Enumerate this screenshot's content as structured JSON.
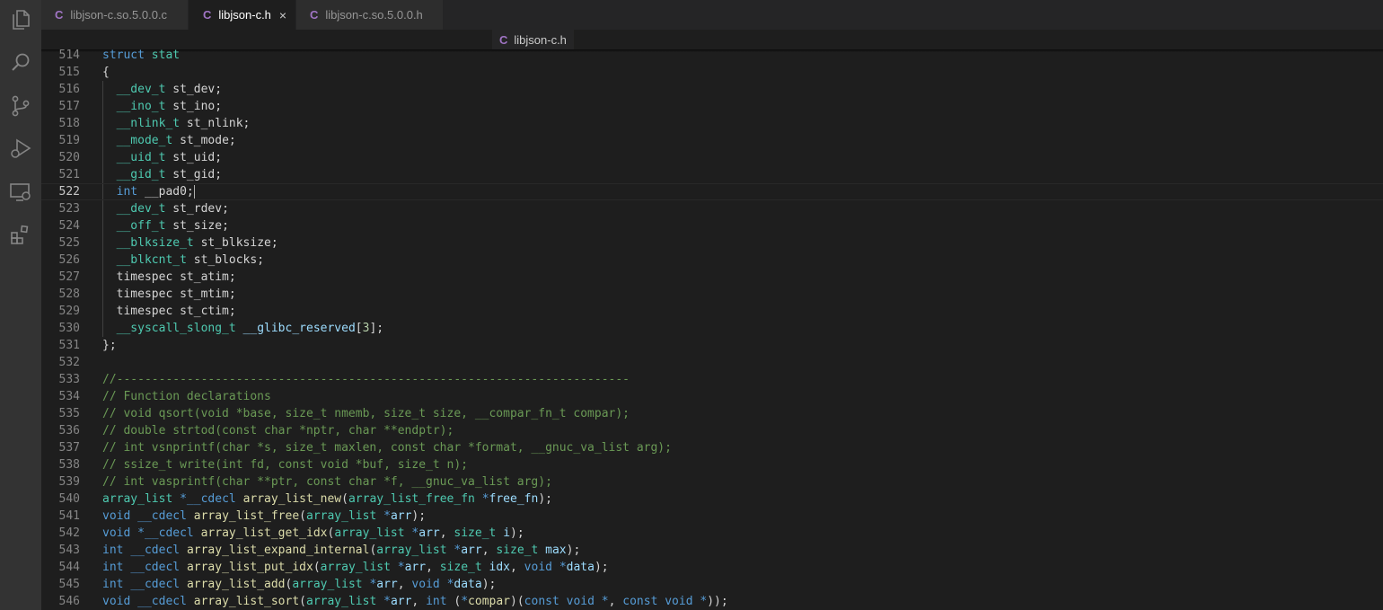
{
  "tabs": [
    {
      "label": "libjson-c.so.5.0.0.c",
      "active": false
    },
    {
      "label": "libjson-c.h",
      "active": true,
      "close": "×"
    },
    {
      "label": "libjson-c.so.5.0.0.h",
      "active": false
    }
  ],
  "file_icon": "C",
  "breadcrumb": {
    "label": "libjson-c.h"
  },
  "activity_icons": [
    "explorer-icon",
    "search-icon",
    "source-control-icon",
    "run-debug-icon",
    "remote-explorer-icon",
    "extensions-icon"
  ],
  "colors": {
    "keyword": "#569cd6",
    "type": "#4ec9b0",
    "function": "#dcdcaa",
    "variable": "#9cdcfe",
    "comment": "#6a9955",
    "number": "#b5cea8",
    "text": "#d4d4d4"
  },
  "editor": {
    "current_line": 522,
    "lines": [
      {
        "n": "514",
        "t": [
          [
            "kw",
            "struct"
          ],
          [
            "",
            " "
          ],
          [
            "ty",
            "stat"
          ]
        ]
      },
      {
        "n": "515",
        "t": [
          [
            "",
            "{"
          ]
        ]
      },
      {
        "n": "516",
        "t": [
          [
            "",
            "  "
          ],
          [
            "ty",
            "__dev_t"
          ],
          [
            "",
            " st_dev;"
          ]
        ]
      },
      {
        "n": "517",
        "t": [
          [
            "",
            "  "
          ],
          [
            "ty",
            "__ino_t"
          ],
          [
            "",
            " st_ino;"
          ]
        ]
      },
      {
        "n": "518",
        "t": [
          [
            "",
            "  "
          ],
          [
            "ty",
            "__nlink_t"
          ],
          [
            "",
            " st_nlink;"
          ]
        ]
      },
      {
        "n": "519",
        "t": [
          [
            "",
            "  "
          ],
          [
            "ty",
            "__mode_t"
          ],
          [
            "",
            " st_mode;"
          ]
        ]
      },
      {
        "n": "520",
        "t": [
          [
            "",
            "  "
          ],
          [
            "ty",
            "__uid_t"
          ],
          [
            "",
            " st_uid;"
          ]
        ]
      },
      {
        "n": "521",
        "t": [
          [
            "",
            "  "
          ],
          [
            "ty",
            "__gid_t"
          ],
          [
            "",
            " st_gid;"
          ]
        ]
      },
      {
        "n": "522",
        "t": [
          [
            "",
            "  "
          ],
          [
            "kw",
            "int"
          ],
          [
            "",
            " __pad0;"
          ]
        ]
      },
      {
        "n": "523",
        "t": [
          [
            "",
            "  "
          ],
          [
            "ty",
            "__dev_t"
          ],
          [
            "",
            " st_rdev;"
          ]
        ]
      },
      {
        "n": "524",
        "t": [
          [
            "",
            "  "
          ],
          [
            "ty",
            "__off_t"
          ],
          [
            "",
            " st_size;"
          ]
        ]
      },
      {
        "n": "525",
        "t": [
          [
            "",
            "  "
          ],
          [
            "ty",
            "__blksize_t"
          ],
          [
            "",
            " st_blksize;"
          ]
        ]
      },
      {
        "n": "526",
        "t": [
          [
            "",
            "  "
          ],
          [
            "ty",
            "__blkcnt_t"
          ],
          [
            "",
            " st_blocks;"
          ]
        ]
      },
      {
        "n": "527",
        "t": [
          [
            "",
            "  timespec st_atim;"
          ]
        ]
      },
      {
        "n": "528",
        "t": [
          [
            "",
            "  timespec st_mtim;"
          ]
        ]
      },
      {
        "n": "529",
        "t": [
          [
            "",
            "  timespec st_ctim;"
          ]
        ]
      },
      {
        "n": "530",
        "t": [
          [
            "",
            "  "
          ],
          [
            "ty",
            "__syscall_slong_t"
          ],
          [
            "",
            " "
          ],
          [
            "va",
            "__glibc_reserved"
          ],
          [
            "",
            "["
          ],
          [
            "nu",
            "3"
          ],
          [
            "",
            "];"
          ]
        ]
      },
      {
        "n": "531",
        "t": [
          [
            "",
            "};"
          ]
        ]
      },
      {
        "n": "532",
        "t": []
      },
      {
        "n": "533",
        "t": [
          [
            "cm",
            "//-------------------------------------------------------------------------"
          ]
        ]
      },
      {
        "n": "534",
        "t": [
          [
            "cm",
            "// Function declarations"
          ]
        ]
      },
      {
        "n": "535",
        "t": [
          [
            "cm",
            "// void qsort(void *base, size_t nmemb, size_t size, __compar_fn_t compar);"
          ]
        ]
      },
      {
        "n": "536",
        "t": [
          [
            "cm",
            "// double strtod(const char *nptr, char **endptr);"
          ]
        ]
      },
      {
        "n": "537",
        "t": [
          [
            "cm",
            "// int vsnprintf(char *s, size_t maxlen, const char *format, __gnuc_va_list arg);"
          ]
        ]
      },
      {
        "n": "538",
        "t": [
          [
            "cm",
            "// ssize_t write(int fd, const void *buf, size_t n);"
          ]
        ]
      },
      {
        "n": "539",
        "t": [
          [
            "cm",
            "// int vasprintf(char **ptr, const char *f, __gnuc_va_list arg);"
          ]
        ]
      },
      {
        "n": "540",
        "t": [
          [
            "ty",
            "array_list"
          ],
          [
            "",
            " "
          ],
          [
            "kw",
            "*__cdecl"
          ],
          [
            "",
            " "
          ],
          [
            "fn",
            "array_list_new"
          ],
          [
            "",
            "("
          ],
          [
            "ty",
            "array_list_free_fn"
          ],
          [
            "",
            " "
          ],
          [
            "kw",
            "*"
          ],
          [
            "va",
            "free_fn"
          ],
          [
            "",
            ");"
          ]
        ]
      },
      {
        "n": "541",
        "t": [
          [
            "kw",
            "void"
          ],
          [
            "",
            " "
          ],
          [
            "kw",
            "__cdecl"
          ],
          [
            "",
            " "
          ],
          [
            "fn",
            "array_list_free"
          ],
          [
            "",
            "("
          ],
          [
            "ty",
            "array_list"
          ],
          [
            "",
            " "
          ],
          [
            "kw",
            "*"
          ],
          [
            "va",
            "arr"
          ],
          [
            "",
            ");"
          ]
        ]
      },
      {
        "n": "542",
        "t": [
          [
            "kw",
            "void"
          ],
          [
            "",
            " "
          ],
          [
            "kw",
            "*__cdecl"
          ],
          [
            "",
            " "
          ],
          [
            "fn",
            "array_list_get_idx"
          ],
          [
            "",
            "("
          ],
          [
            "ty",
            "array_list"
          ],
          [
            "",
            " "
          ],
          [
            "kw",
            "*"
          ],
          [
            "va",
            "arr"
          ],
          [
            ", "
          ],
          [
            "ty",
            "size_t"
          ],
          [
            "",
            " "
          ],
          [
            "va",
            "i"
          ],
          [
            "",
            ");"
          ]
        ]
      },
      {
        "n": "543",
        "t": [
          [
            "kw",
            "int"
          ],
          [
            "",
            " "
          ],
          [
            "kw",
            "__cdecl"
          ],
          [
            "",
            " "
          ],
          [
            "fn",
            "array_list_expand_internal"
          ],
          [
            "",
            "("
          ],
          [
            "ty",
            "array_list"
          ],
          [
            "",
            " "
          ],
          [
            "kw",
            "*"
          ],
          [
            "va",
            "arr"
          ],
          [
            ", "
          ],
          [
            "ty",
            "size_t"
          ],
          [
            "",
            " "
          ],
          [
            "va",
            "max"
          ],
          [
            "",
            ");"
          ]
        ]
      },
      {
        "n": "544",
        "t": [
          [
            "kw",
            "int"
          ],
          [
            "",
            " "
          ],
          [
            "kw",
            "__cdecl"
          ],
          [
            "",
            " "
          ],
          [
            "fn",
            "array_list_put_idx"
          ],
          [
            "",
            "("
          ],
          [
            "ty",
            "array_list"
          ],
          [
            "",
            " "
          ],
          [
            "kw",
            "*"
          ],
          [
            "va",
            "arr"
          ],
          [
            ", "
          ],
          [
            "ty",
            "size_t"
          ],
          [
            "",
            " "
          ],
          [
            "va",
            "idx"
          ],
          [
            ", "
          ],
          [
            "kw",
            "void"
          ],
          [
            "",
            " "
          ],
          [
            "kw",
            "*"
          ],
          [
            "va",
            "data"
          ],
          [
            "",
            ");"
          ]
        ]
      },
      {
        "n": "545",
        "t": [
          [
            "kw",
            "int"
          ],
          [
            "",
            " "
          ],
          [
            "kw",
            "__cdecl"
          ],
          [
            "",
            " "
          ],
          [
            "fn",
            "array_list_add"
          ],
          [
            "",
            "("
          ],
          [
            "ty",
            "array_list"
          ],
          [
            "",
            " "
          ],
          [
            "kw",
            "*"
          ],
          [
            "va",
            "arr"
          ],
          [
            ", "
          ],
          [
            "kw",
            "void"
          ],
          [
            "",
            " "
          ],
          [
            "kw",
            "*"
          ],
          [
            "va",
            "data"
          ],
          [
            "",
            ");"
          ]
        ]
      },
      {
        "n": "546",
        "t": [
          [
            "kw",
            "void"
          ],
          [
            "",
            " "
          ],
          [
            "kw",
            "__cdecl"
          ],
          [
            "",
            " "
          ],
          [
            "fn",
            "array_list_sort"
          ],
          [
            "",
            "("
          ],
          [
            "ty",
            "array_list"
          ],
          [
            "",
            " "
          ],
          [
            "kw",
            "*"
          ],
          [
            "va",
            "arr"
          ],
          [
            ", "
          ],
          [
            "kw",
            "int"
          ],
          [
            "",
            " ("
          ],
          [
            "kw",
            "*"
          ],
          [
            "fn",
            "compar"
          ],
          [
            ")("
          ],
          [
            "kw",
            "const"
          ],
          [
            "",
            " "
          ],
          [
            "kw",
            "void"
          ],
          [
            "",
            " "
          ],
          [
            "kw",
            "*"
          ],
          [
            ", "
          ],
          [
            "kw",
            "const"
          ],
          [
            "",
            " "
          ],
          [
            "kw",
            "void"
          ],
          [
            "",
            " "
          ],
          [
            "kw",
            "*"
          ],
          [
            "",
            "));"
          ]
        ]
      }
    ]
  }
}
